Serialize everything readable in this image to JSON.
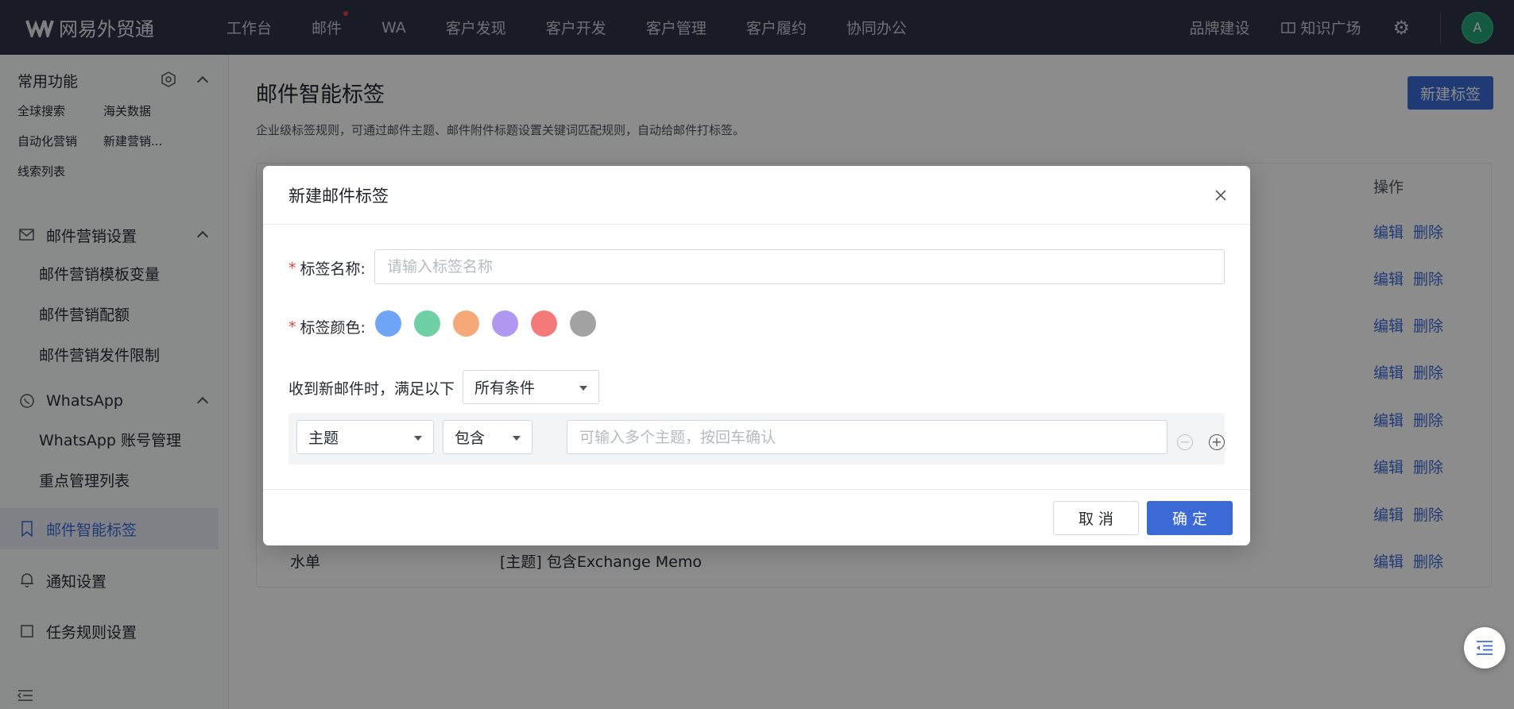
{
  "brand": {
    "name": "网易外贸通"
  },
  "nav": [
    {
      "label": "工作台",
      "dot": false
    },
    {
      "label": "邮件",
      "dot": true
    },
    {
      "label": "WA",
      "dot": false
    },
    {
      "label": "客户发现",
      "dot": false
    },
    {
      "label": "客户开发",
      "dot": false
    },
    {
      "label": "客户管理",
      "dot": false
    },
    {
      "label": "客户履约",
      "dot": false
    },
    {
      "label": "协同办公",
      "dot": false
    }
  ],
  "top_right": {
    "brand_build": "品牌建设",
    "knowledge": "知识广场",
    "avatar": "A"
  },
  "sidebar": {
    "common_title": "常用功能",
    "quick": [
      "全球搜索",
      "海关数据",
      "自动化营销",
      "新建营销...",
      "线索列表"
    ],
    "groups": [
      {
        "label": "邮件营销设置",
        "items": [
          "邮件营销模板变量",
          "邮件营销配额",
          "邮件营销发件限制"
        ]
      },
      {
        "label": "WhatsApp",
        "items": [
          "WhatsApp 账号管理",
          "重点管理列表"
        ]
      }
    ],
    "active": "邮件智能标签",
    "notify": "通知设置",
    "task_rules": "任务规则设置"
  },
  "page": {
    "title": "邮件智能标签",
    "desc": "企业级标签规则，可通过邮件主题、邮件附件标题设置关键词匹配规则，自动给邮件打标签。",
    "new_button": "新建标签"
  },
  "table": {
    "op_header": "操作",
    "edit": "编辑",
    "delete": "删除",
    "last_row": {
      "name": "水单",
      "rule": "[主题] 包含Exchange Memo"
    }
  },
  "modal": {
    "title": "新建邮件标签",
    "name_label": "标签名称:",
    "name_placeholder": "请输入标签名称",
    "color_label": "标签颜色:",
    "colors": [
      "#4a90f5",
      "#36b98a",
      "#f39a5a",
      "#9a7bf0",
      "#f04c4c",
      "#8c8c8c"
    ],
    "condition_prefix": "收到新邮件时，满足以下",
    "condition_mode": "所有条件",
    "field": "主题",
    "operator": "包含",
    "keyword_placeholder": "可输入多个主题，按回车确认",
    "cancel": "取 消",
    "ok": "确 定"
  }
}
